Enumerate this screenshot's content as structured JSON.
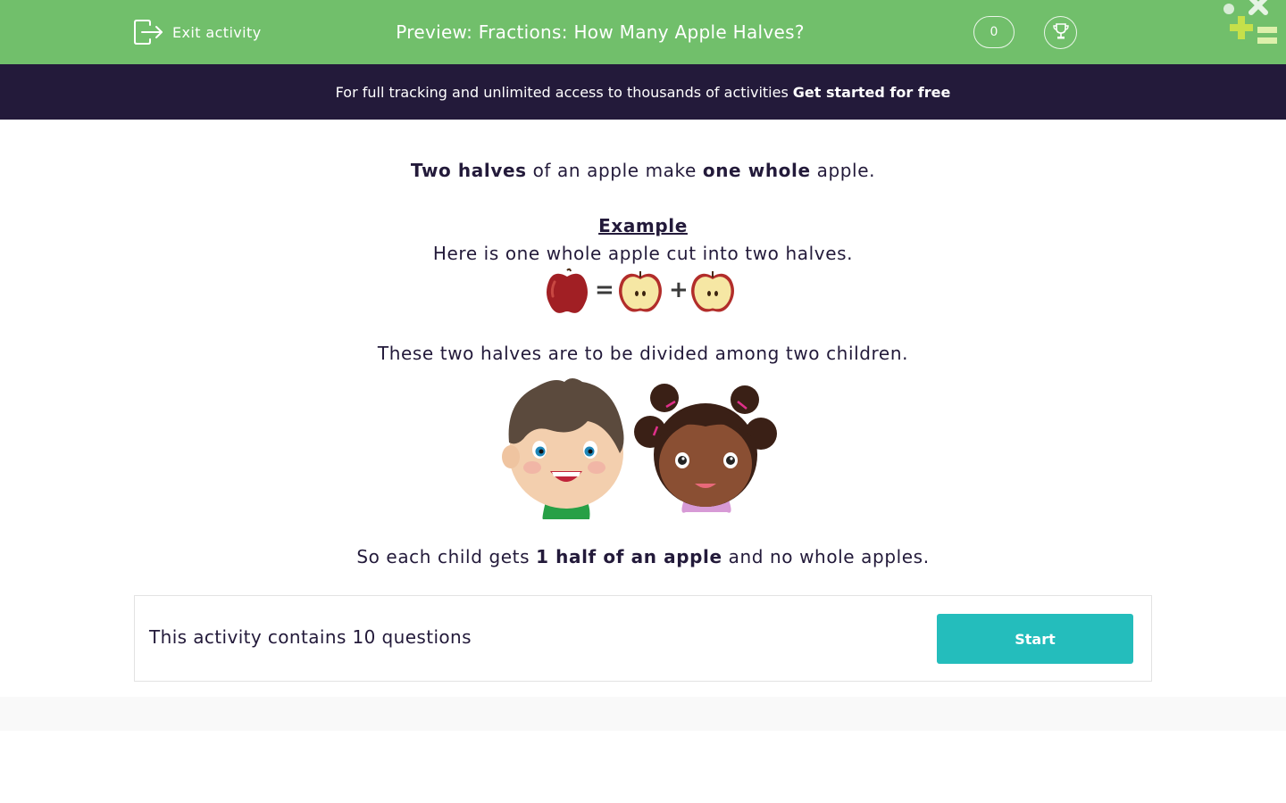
{
  "header": {
    "exit_label": "Exit activity",
    "title": "Preview: Fractions: How Many Apple Halves?",
    "score": "0",
    "background_color": "#71bf6b"
  },
  "promo": {
    "text": "For full tracking and unlimited access to thousands of activities",
    "cta": "Get started for free",
    "background_color": "#231a3a"
  },
  "content": {
    "intro": {
      "part1_bold": "Two halves",
      "part2": " of an apple make ",
      "part3_bold": "one whole",
      "part4": " apple."
    },
    "example_heading": "Example",
    "example_text": "Here is one whole apple cut into two halves.",
    "equation": {
      "equals": "=",
      "plus": "+",
      "items": [
        "whole-apple-icon",
        "apple-half-icon",
        "apple-half-icon"
      ]
    },
    "children_text": "These two halves are to be divided among two children.",
    "conclusion": {
      "part1": "So each child gets ",
      "part2_bold": "1 half of an apple",
      "part3": " and no whole apples."
    }
  },
  "panel": {
    "question_count_text": "This activity contains 10 questions",
    "start_label": "Start",
    "start_color": "#24bdbc"
  }
}
